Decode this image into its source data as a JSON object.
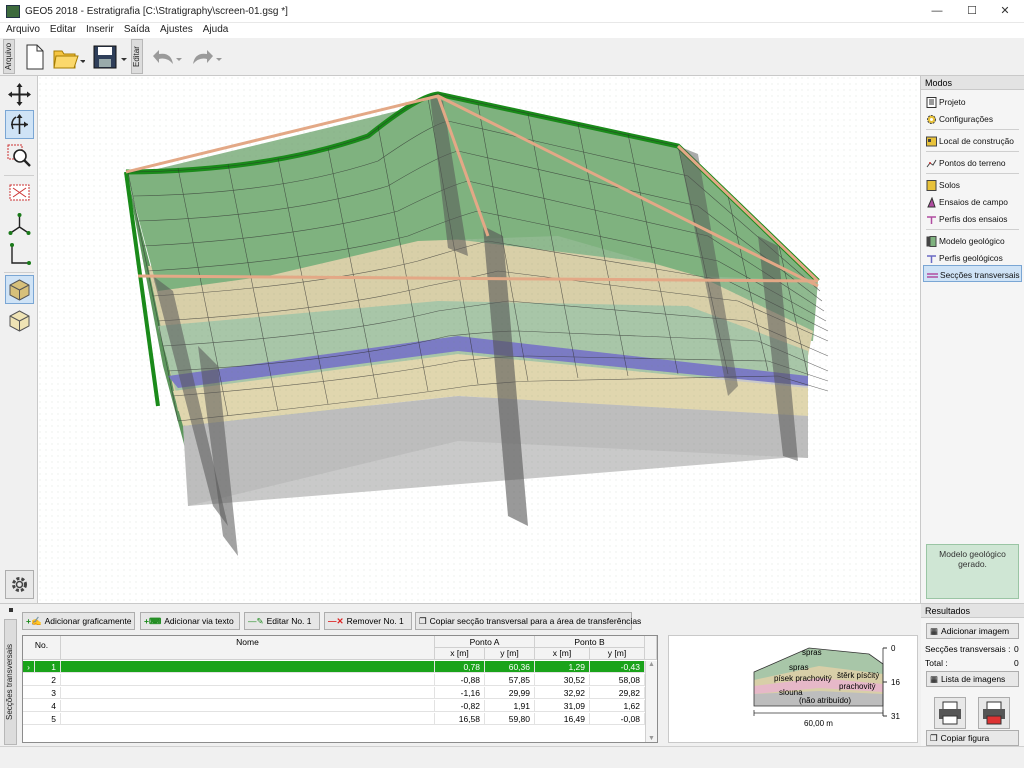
{
  "window": {
    "title": "GEO5 2018 - Estratigrafia [C:\\Stratigraphy\\screen-01.gsg *]"
  },
  "menu": [
    "Arquivo",
    "Editar",
    "Inserir",
    "Saída",
    "Ajustes",
    "Ajuda"
  ],
  "toolbar": {
    "arquivo_tab": "Arquivo",
    "editar_tab": "Editar"
  },
  "right_panel": {
    "header": "Modos",
    "items": [
      {
        "label": "Projeto",
        "icon": "document-icon"
      },
      {
        "label": "Configurações",
        "icon": "gear-icon"
      },
      {
        "label": "Local de construção",
        "icon": "map-icon"
      },
      {
        "label": "Pontos do terreno",
        "icon": "terrain-point-icon"
      },
      {
        "label": "Solos",
        "icon": "soil-icon"
      },
      {
        "label": "Ensaios de campo",
        "icon": "field-test-icon"
      },
      {
        "label": "Perfis dos ensaios",
        "icon": "test-profile-icon"
      },
      {
        "label": "Modelo geológico",
        "icon": "geological-model-icon"
      },
      {
        "label": "Perfis geológicos",
        "icon": "geological-profile-icon"
      },
      {
        "label": "Secções transversais",
        "icon": "cross-section-icon"
      }
    ],
    "selected_index": 9,
    "info_box": "Modelo geológico gerado."
  },
  "bottom": {
    "side_tab": "Secções transversais",
    "buttons": {
      "add_graphic": "Adicionar graficamente",
      "add_text": "Adicionar via texto",
      "edit": "Editar No. 1",
      "remove": "Remover No. 1",
      "copy": "Copiar secção transversal para a área de transferências"
    },
    "table": {
      "col_no": "No.",
      "col_name": "Nome",
      "group_a": "Ponto A",
      "group_b": "Ponto B",
      "sub_x": "x [m]",
      "sub_y": "y [m]",
      "rows": [
        {
          "no": "1",
          "name": "",
          "ax": "0,78",
          "ay": "60,36",
          "bx": "1,29",
          "by": "-0,43"
        },
        {
          "no": "2",
          "name": "",
          "ax": "-0,88",
          "ay": "57,85",
          "bx": "30,52",
          "by": "58,08"
        },
        {
          "no": "3",
          "name": "",
          "ax": "-1,16",
          "ay": "29,99",
          "bx": "32,92",
          "by": "29,82"
        },
        {
          "no": "4",
          "name": "",
          "ax": "-0,82",
          "ay": "1,91",
          "bx": "31,09",
          "by": "1,62"
        },
        {
          "no": "5",
          "name": "",
          "ax": "16,58",
          "ay": "59,80",
          "bx": "16,49",
          "by": "-0,08"
        }
      ],
      "selected_row": 0,
      "selected_color": "#1aa31a"
    },
    "preview": {
      "labels": [
        "spras",
        "písek prachovitý",
        "štěrk písčitý",
        "slouna",
        "prachovitý",
        "(não atribuído)",
        "spras"
      ],
      "depth_ticks": [
        "0",
        "16",
        "31"
      ],
      "length": "60,00 m"
    }
  },
  "results": {
    "header": "Resultados",
    "add_image": "Adicionar imagem",
    "sections_label": "Secções transversais :",
    "sections_value": "0",
    "total_label": "Total :",
    "total_value": "0",
    "image_list": "Lista de imagens",
    "copy_figure": "Copiar figura"
  },
  "colors": {
    "accent": "#1aa31a",
    "selection": "#cfe3f6",
    "green_layer": "#7fb27f",
    "sand_layer": "#d8cfa8",
    "clay_layer": "#8080c0",
    "gray_layer": "#bdbdbd"
  }
}
